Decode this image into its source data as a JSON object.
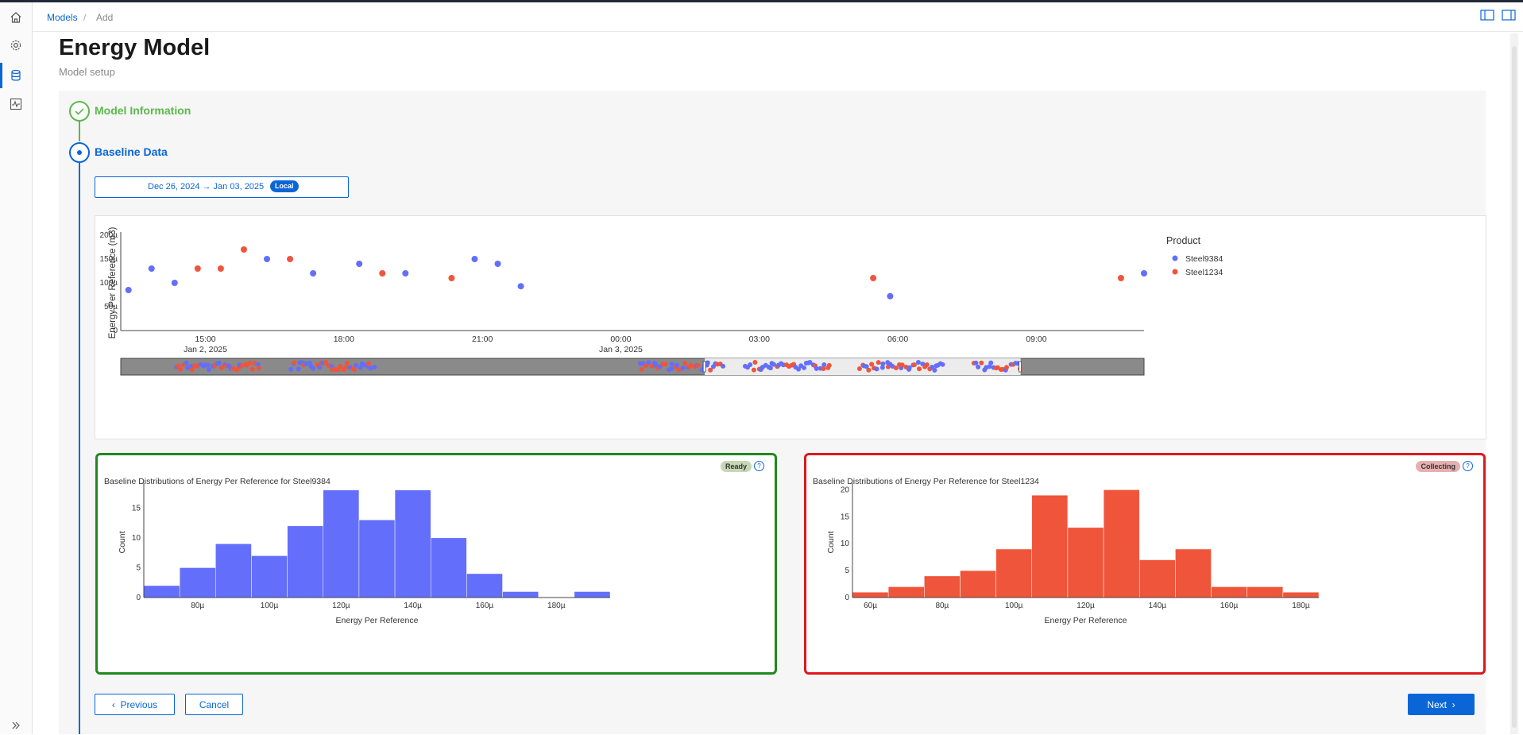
{
  "breadcrumb": {
    "models": "Models",
    "separator": "/",
    "add": "Add"
  },
  "page": {
    "title": "Energy Model",
    "subtitle": "Model setup"
  },
  "steps": [
    {
      "label": "Model Information",
      "state": "complete"
    },
    {
      "label": "Baseline Data",
      "state": "active"
    }
  ],
  "date_range": {
    "text": "Dec 26, 2024 → Jan 03, 2025",
    "badge": "Local"
  },
  "buttons": {
    "previous": "Previous",
    "cancel": "Cancel",
    "next": "Next"
  },
  "colors": {
    "accent": "#0a66d6",
    "steel9384": "#636efa",
    "steel1234": "#ef553b",
    "ready": "#1e8a1e",
    "collecting": "#e0161d"
  },
  "icons": {
    "home": "home-icon",
    "settings": "gear-icon",
    "models": "database-icon",
    "monitor": "activity-icon",
    "expand": "double-chevron-right-icon"
  },
  "chart_data": [
    {
      "type": "scatter",
      "title": "",
      "xlabel": "",
      "ylabel": "Energy Per Reference (m3)",
      "ylim": [
        0,
        200
      ],
      "y_unit": "µ",
      "y_ticks": [
        0,
        50,
        100,
        150,
        200
      ],
      "y_tick_labels": [
        "0",
        "50µ",
        "100µ",
        "150µ",
        "200µ"
      ],
      "x_ticks": [
        {
          "t": "2025-01-02T15:00",
          "label": "15:00",
          "sub": "Jan 2, 2025"
        },
        {
          "t": "2025-01-02T18:00",
          "label": "18:00",
          "sub": ""
        },
        {
          "t": "2025-01-02T21:00",
          "label": "21:00",
          "sub": ""
        },
        {
          "t": "2025-01-03T00:00",
          "label": "00:00",
          "sub": "Jan 3, 2025"
        },
        {
          "t": "2025-01-03T03:00",
          "label": "03:00",
          "sub": ""
        },
        {
          "t": "2025-01-03T06:00",
          "label": "06:00",
          "sub": ""
        },
        {
          "t": "2025-01-03T09:00",
          "label": "09:00",
          "sub": ""
        }
      ],
      "xlim": [
        "2025-01-02T13:10",
        "2025-01-03T11:20"
      ],
      "legend": {
        "title": "Product",
        "position": "right"
      },
      "grid": false,
      "series": [
        {
          "name": "Steel9384",
          "color": "#636efa",
          "points": [
            {
              "t": "2025-01-02T13:20",
              "y": 85
            },
            {
              "t": "2025-01-02T13:50",
              "y": 130
            },
            {
              "t": "2025-01-02T14:20",
              "y": 100
            },
            {
              "t": "2025-01-02T16:20",
              "y": 150
            },
            {
              "t": "2025-01-02T17:20",
              "y": 120
            },
            {
              "t": "2025-01-02T18:20",
              "y": 140
            },
            {
              "t": "2025-01-02T19:20",
              "y": 120
            },
            {
              "t": "2025-01-02T20:50",
              "y": 150
            },
            {
              "t": "2025-01-02T21:20",
              "y": 140
            },
            {
              "t": "2025-01-02T21:50",
              "y": 93
            },
            {
              "t": "2025-01-03T05:50",
              "y": 72
            },
            {
              "t": "2025-01-03T11:20",
              "y": 120
            }
          ]
        },
        {
          "name": "Steel1234",
          "color": "#ef553b",
          "points": [
            {
              "t": "2025-01-02T14:50",
              "y": 130
            },
            {
              "t": "2025-01-02T15:20",
              "y": 130
            },
            {
              "t": "2025-01-02T15:50",
              "y": 170
            },
            {
              "t": "2025-01-02T16:50",
              "y": 150
            },
            {
              "t": "2025-01-02T18:50",
              "y": 120
            },
            {
              "t": "2025-01-02T20:20",
              "y": 110
            },
            {
              "t": "2025-01-03T05:28",
              "y": 110
            },
            {
              "t": "2025-01-03T10:50",
              "y": 110
            }
          ]
        }
      ],
      "range_slider": {
        "clusters": [
          {
            "t0": "2025-01-01T00:00",
            "t1": "2025-01-01T06:00"
          },
          {
            "t0": "2025-01-01T08:00",
            "t1": "2025-01-01T14:00"
          },
          {
            "t0": "2025-01-02T08:30",
            "t1": "2025-01-02T14:30"
          },
          {
            "t0": "2025-01-02T16:00",
            "t1": "2025-01-02T22:00"
          },
          {
            "t0": "2025-01-03T00:00",
            "t1": "2025-01-03T06:00"
          },
          {
            "t0": "2025-01-03T08:00",
            "t1": "2025-01-03T11:20"
          }
        ],
        "xlim": [
          "2024-12-31T20:10",
          "2025-01-03T20:00"
        ],
        "window": [
          "2025-01-02T13:10",
          "2025-01-03T11:20"
        ]
      }
    },
    {
      "type": "bar",
      "title": "Baseline Distributions of Energy Per Reference for Steel9384",
      "xlabel": "Energy Per Reference",
      "ylabel": "Count",
      "status": "Ready",
      "help": "?",
      "color": "#636efa",
      "bin_start": 65,
      "bin_width": 10,
      "values": [
        2,
        5,
        9,
        7,
        12,
        18,
        13,
        18,
        10,
        4,
        1,
        0,
        1
      ],
      "xlim": [
        65,
        195
      ],
      "ylim": [
        0,
        18.5
      ],
      "x_ticks": [
        80,
        100,
        120,
        140,
        160,
        180
      ],
      "y_ticks": [
        0,
        5,
        10,
        15
      ],
      "x_tick_suffix": "µ"
    },
    {
      "type": "bar",
      "title": "Baseline Distributions of Energy Per Reference for Steel1234",
      "xlabel": "Energy Per Reference",
      "ylabel": "Count",
      "status": "Collecting",
      "help": "?",
      "color": "#ef553b",
      "bin_start": 55,
      "bin_width": 10,
      "values": [
        1,
        2,
        4,
        5,
        9,
        19,
        13,
        20,
        7,
        9,
        2,
        2,
        1
      ],
      "xlim": [
        55,
        185
      ],
      "ylim": [
        0,
        20.5
      ],
      "x_ticks": [
        60,
        80,
        100,
        120,
        140,
        160,
        180
      ],
      "y_ticks": [
        0,
        5,
        10,
        15,
        20
      ],
      "x_tick_suffix": "µ"
    }
  ]
}
